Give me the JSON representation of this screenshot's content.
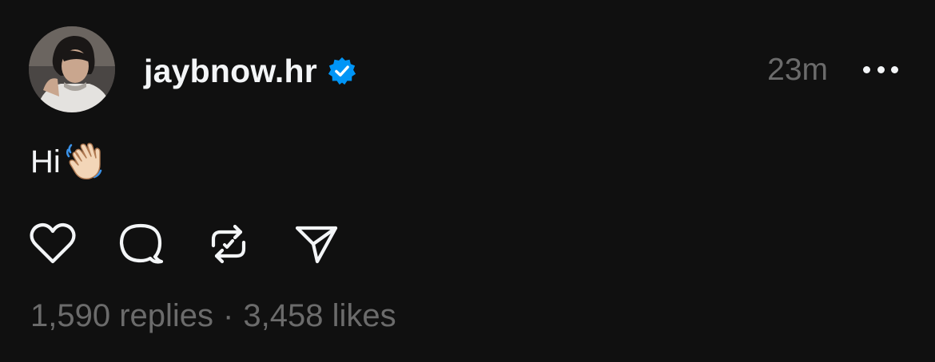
{
  "post": {
    "username": "jaybnow.hr",
    "verified": true,
    "timestamp": "23m",
    "text": "Hi",
    "emoji": "waving-hand",
    "replies": "1,590 replies",
    "separator": "·",
    "likes": "3,458 likes"
  },
  "icons": {
    "like": "heart-icon",
    "reply": "comment-bubble-icon",
    "repost": "repost-arrows-icon",
    "share": "send-paper-plane-icon",
    "more": "more-horizontal-icon",
    "verified": "verified-badge-icon"
  },
  "colors": {
    "background": "#101010",
    "primary_text": "#f3f5f7",
    "secondary_text": "#6b6b6b",
    "verified_blue": "#0095f6"
  }
}
